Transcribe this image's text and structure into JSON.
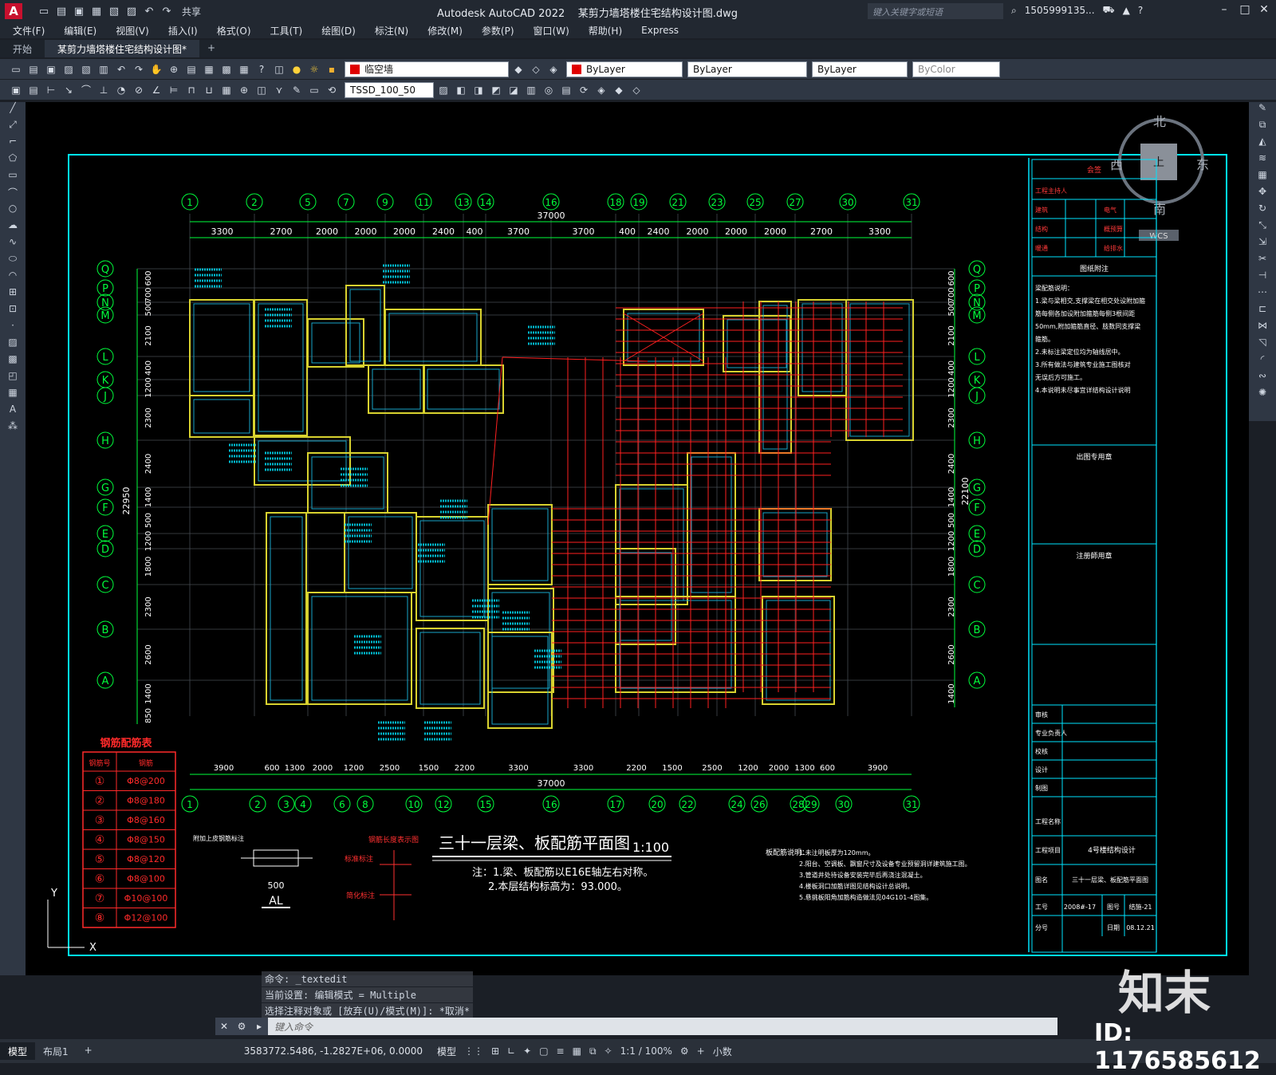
{
  "titlebar": {
    "app_title": "Autodesk AutoCAD 2022",
    "file_title": "某剪力墙塔楼住宅结构设计图.dwg",
    "share": "共享",
    "search_placeholder": "键入关键字或短语",
    "user": "1505999135...",
    "quick_access": [
      "new-icon",
      "open-icon",
      "save-icon",
      "saveas-icon",
      "web-icon",
      "print-icon",
      "undo-icon",
      "redo-icon"
    ]
  },
  "menu": [
    "文件(F)",
    "编辑(E)",
    "视图(V)",
    "插入(I)",
    "格式(O)",
    "工具(T)",
    "绘图(D)",
    "标注(N)",
    "修改(M)",
    "参数(P)",
    "窗口(W)",
    "帮助(H)",
    "Express"
  ],
  "tabs": {
    "start": "开始",
    "document": "某剪力墙塔楼住宅结构设计图*",
    "add": "+"
  },
  "toolbar": {
    "layer": "临空墙",
    "color": "ByLayer",
    "linetype": "ByLayer",
    "lineweight": "ByLayer",
    "plotstyle": "ByColor",
    "dimstyle": "TSSD_100_50"
  },
  "viewcube": {
    "north": "北",
    "south": "南",
    "east": "东",
    "west": "西",
    "top": "上",
    "wcs": "WCS"
  },
  "drawing": {
    "title": "三十一层梁、板配筋平面图",
    "scale": "1:100",
    "note1": "注：1.梁、板配筋以E16E轴左右对称。",
    "note2": "2.本层结构标高为：93.000。",
    "total_dim": "37000",
    "left_total": "22950",
    "right_total": "22100",
    "top_axes": [
      "1",
      "2",
      "5",
      "7",
      "9",
      "11",
      "13",
      "14",
      "16",
      "18",
      "19",
      "21",
      "23",
      "25",
      "27",
      "30",
      "31"
    ],
    "top_dims": [
      "3300",
      "2700",
      "2000",
      "2000",
      "2000",
      "2400",
      "400",
      "3700",
      "3700",
      "400",
      "2400",
      "2000",
      "2000",
      "2000",
      "2700",
      "3300"
    ],
    "bottom_axes": [
      "1",
      "2",
      "3",
      "4",
      "6",
      "8",
      "10",
      "12",
      "15",
      "16",
      "17",
      "20",
      "22",
      "24",
      "26",
      "28",
      "29",
      "30",
      "31"
    ],
    "bottom_dims": [
      "3900",
      "600",
      "1300",
      "2000",
      "1200",
      "2500",
      "1500",
      "2200",
      "3300",
      "3300",
      "2200",
      "1500",
      "2500",
      "1200",
      "2000",
      "1300",
      "600",
      "3900"
    ],
    "row_axes": [
      "Q",
      "P",
      "N",
      "M",
      "L",
      "K",
      "J",
      "H",
      "G",
      "F",
      "E",
      "D",
      "C",
      "B",
      "A"
    ],
    "left_dims": [
      "600",
      "700",
      "500",
      "2100",
      "400",
      "1200",
      "2300",
      "2400",
      "1400",
      "500",
      "1200",
      "1800",
      "2300",
      "2600",
      "1400",
      "850"
    ],
    "right_dims": [
      "600",
      "700",
      "500",
      "2100",
      "400",
      "1200",
      "2300",
      "2400",
      "1400",
      "500",
      "1200",
      "1800",
      "2300",
      "2600",
      "1400"
    ],
    "rebar_table_title": "钢筋配筋表",
    "rebar_table_headers": [
      "钢筋号",
      "钢筋"
    ],
    "rebar_table": [
      {
        "no": "①",
        "spec": "Φ8@200"
      },
      {
        "no": "②",
        "spec": "Φ8@180"
      },
      {
        "no": "③",
        "spec": "Φ8@160"
      },
      {
        "no": "④",
        "spec": "Φ8@150"
      },
      {
        "no": "⑤",
        "spec": "Φ8@120"
      },
      {
        "no": "⑥",
        "spec": "Φ8@100"
      },
      {
        "no": "⑦",
        "spec": "Φ10@100"
      },
      {
        "no": "⑧",
        "spec": "Φ12@100"
      }
    ],
    "section_title": "钢筋长度表示图",
    "section_labels": [
      "标准标注",
      "简化标注"
    ],
    "detail_label": "AL",
    "detail_dim": "500",
    "detail_caption": "附加上皮钢筋标注",
    "slab_notes_title": "板配筋说明：",
    "slab_notes": [
      "1.未注明板厚为120mm。",
      "2.阳台、空调板、飘窗尺寸及设备专业预留洞详建筑施工图。",
      "3.管道井处待设备安装完毕后再浇注混凝土。",
      "4.楼板洞口加筋详图见结构设计总说明。",
      "5.悬挑板阳角加筋构造做法见04G101-4图集。"
    ]
  },
  "titleblock": {
    "header": "会签",
    "rows_top": [
      "工程主持人",
      "建筑",
      "结构",
      "暖通",
      "给排水",
      "电气",
      "概预算"
    ],
    "notes_title": "图纸附注",
    "notes": [
      "梁配筋说明：",
      "1.梁与梁相交,支撑梁在相交处设附加箍筋每侧各加设附加箍筋每侧3根间距50mm,附加箍筋直径、肢数同支撑梁箍筋。",
      "2.未标注梁定位均为轴线居中。",
      "3.所有做法与建筑专业施工图核对无误后方可施工。",
      "4.本说明未尽事宜详结构设计说明"
    ],
    "stamp1": "出图专用章",
    "stamp2": "注册師用章",
    "sign_rows": [
      "审核",
      "专业负责人",
      "校核",
      "设计",
      "制图"
    ],
    "project_name_label": "工程名称",
    "project_label": "工程项目",
    "project_value": "4号楼结构设计",
    "drawing_name_label": "图名",
    "drawing_name_value": "三十一层梁、板配筋平面图",
    "job_label": "工号",
    "job_value": "2008#-17",
    "sheet_label": "图号",
    "sheet_value": "结施-21",
    "series_label": "分号",
    "date_label": "日期",
    "date_value": "08.12.21"
  },
  "command": {
    "history": [
      "命令: _textedit",
      "当前设置: 编辑模式 = Multiple",
      "选择注释对象或 [放弃(U)/模式(M)]: *取消*"
    ],
    "placeholder": "键入命令"
  },
  "status": {
    "layouts": [
      "模型",
      "布局1",
      "+"
    ],
    "coords": "3583772.5486, -1.2827E+06, 0.0000",
    "space": "模型",
    "scale": "1:1 / 100%",
    "units": "小数"
  },
  "watermark": {
    "logo": "知末",
    "id": "ID: 1176585612"
  }
}
